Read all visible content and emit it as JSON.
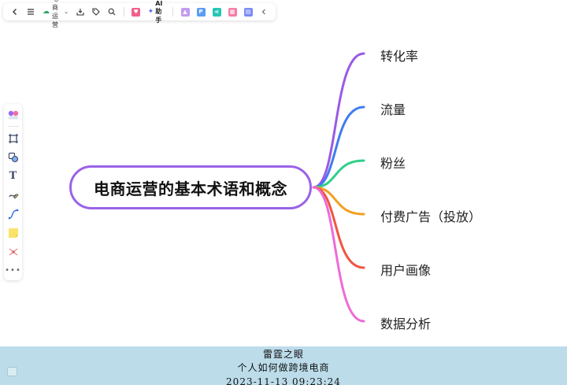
{
  "toolbar": {
    "doc_title": "电商运营",
    "ai_label": "AI助手",
    "p_badge": "P"
  },
  "mindmap": {
    "root": "电商运营的基本术语和概念",
    "root_color": "#9a62e8",
    "branches": [
      {
        "label": "转化率",
        "color": "#9b59e6"
      },
      {
        "label": "流量",
        "color": "#3f7cf0"
      },
      {
        "label": "粉丝",
        "color": "#2fcf8a"
      },
      {
        "label": "付费广告（投放）",
        "color": "#f0a023"
      },
      {
        "label": "用户画像",
        "color": "#f0553f"
      },
      {
        "label": "数据分析",
        "color": "#ef6bd6"
      }
    ]
  },
  "watermark": {
    "line1": "雷霆之眼",
    "line2": "个人如何做跨境电商",
    "line3": "2023-11-13 09:23:24"
  }
}
